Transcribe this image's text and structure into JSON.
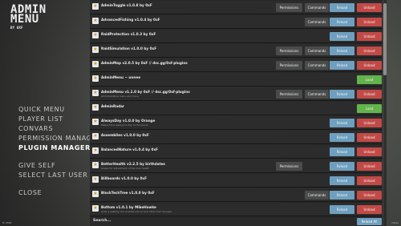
{
  "app": {
    "title_line1": "ADMIN",
    "title_line2": "MENU",
    "by": "BY 0XF"
  },
  "nav": {
    "items": [
      "QUICK MENU",
      "PLAYER LIST",
      "CONVARS",
      "PERMISSION MANAGER",
      "PLUGIN MANAGER"
    ],
    "items2": [
      "GIVE SELF",
      "SELECT LAST USER"
    ],
    "close": "CLOSE",
    "active": "PLUGIN MANAGER"
  },
  "corner": {
    "left": "tf. 2041",
    "right": "Oxide"
  },
  "labels": {
    "permissions": "Permissions",
    "commands": "Commands",
    "reload": "Reload",
    "unload": "Unload",
    "load": "Load"
  },
  "plugins": [
    {
      "name": "AdminToggle v1.0.8 by 0xF",
      "desc": "",
      "perm": true,
      "cmd": true,
      "state": "loaded"
    },
    {
      "name": "AdvancedFishing v1.0.4 by 0xF",
      "desc": "",
      "perm": false,
      "cmd": true,
      "state": "loaded"
    },
    {
      "name": "RaidProtection v1.0.3 by 0xF",
      "desc": "",
      "perm": false,
      "cmd": false,
      "state": "loaded"
    },
    {
      "name": "RaidSimulation v1.0.0 by 0xF",
      "desc": "",
      "perm": true,
      "cmd": true,
      "state": "loaded"
    },
    {
      "name": "AdminMap v2.0.5 by 0xF // dsc.gg/0xf-plugins",
      "desc": "",
      "perm": true,
      "cmd": true,
      "state": "loaded"
    },
    {
      "name": "AdminMenu ~ unnee",
      "desc": "",
      "perm": false,
      "cmd": false,
      "state": "unloaded"
    },
    {
      "name": "AdminMenu v1.1.0 by 0xF // dsc.gg/0xf-plugins",
      "desc": "Administrative menu and more",
      "perm": true,
      "cmd": true,
      "state": "loaded"
    },
    {
      "name": "AdminRadar",
      "desc": "",
      "perm": false,
      "cmd": false,
      "state": "unloaded"
    },
    {
      "name": "AlwaysDay v1.0.0 by Orange",
      "desc": "Makes time always to day in the server",
      "perm": false,
      "cmd": false,
      "state": "loaded"
    },
    {
      "name": "Assemblies v1.0.0 by 0xF",
      "desc": "",
      "perm": false,
      "cmd": false,
      "state": "loaded"
    },
    {
      "name": "BalancedNature v1.0.4 by 0xF",
      "desc": "",
      "perm": false,
      "cmd": false,
      "state": "loaded"
    },
    {
      "name": "BetterHealth v2.2.5 by birthdates",
      "desc": "Allows for adjustment of the max health",
      "perm": true,
      "cmd": false,
      "state": "loaded"
    },
    {
      "name": "Billboards v1.0.0 by 0xF",
      "desc": "",
      "perm": false,
      "cmd": false,
      "state": "loaded"
    },
    {
      "name": "BlockTechTree v1.0.0 by 0xF",
      "desc": "",
      "perm": false,
      "cmd": true,
      "state": "loaded"
    },
    {
      "name": "Bottom v1.0.1 by MikeHawke",
      "desc": "Adds a pasting role of skills add-on and other PvE changes",
      "perm": false,
      "cmd": false,
      "state": "loaded"
    }
  ],
  "footer": {
    "search_label": "Search...",
    "reload_all": "Reload All"
  },
  "colors": {
    "reload": "#6f9fbf",
    "unload": "#c24a46",
    "load": "#63b44c"
  }
}
